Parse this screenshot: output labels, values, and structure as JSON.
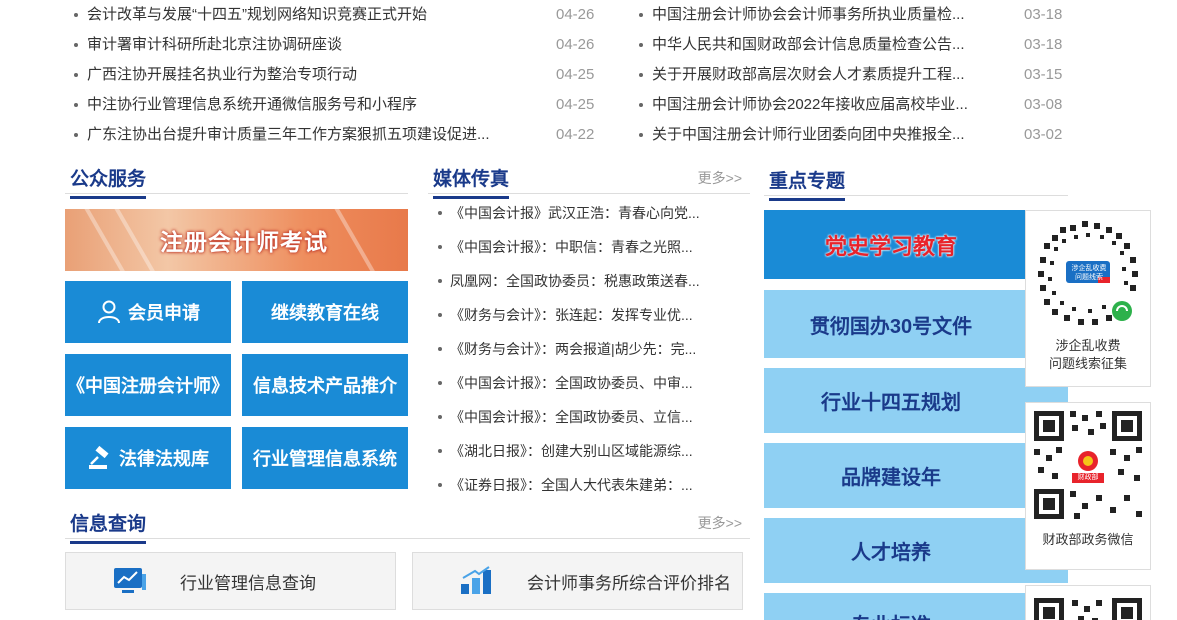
{
  "top_news_left": [
    {
      "title": "会计改革与发展“十四五”规划网络知识竞赛正式开始",
      "date": "04-26"
    },
    {
      "title": "审计署审计科研所赴北京注协调研座谈",
      "date": "04-26"
    },
    {
      "title": "广西注协开展挂名执业行为整治专项行动",
      "date": "04-25"
    },
    {
      "title": "中注协行业管理信息系统开通微信服务号和小程序",
      "date": "04-25"
    },
    {
      "title": "广东注协出台提升审计质量三年工作方案狠抓五项建设促进...",
      "date": "04-22"
    }
  ],
  "top_news_right": [
    {
      "title": "中国注册会计师协会会计师事务所执业质量检...",
      "date": "03-18"
    },
    {
      "title": "中华人民共和国财政部会计信息质量检查公告...",
      "date": "03-18"
    },
    {
      "title": "关于开展财政部高层次财会人才素质提升工程...",
      "date": "03-15"
    },
    {
      "title": "中国注册会计师协会2022年接收应届高校毕业...",
      "date": "03-08"
    },
    {
      "title": "关于中国注册会计师行业团委向团中央推报全...",
      "date": "03-02"
    }
  ],
  "public_service": {
    "title": "公众服务",
    "banner": "注册会计师考试",
    "buttons": [
      "会员申请",
      "继续教育在线",
      "《中国注册会计师》",
      "信息技术产品推介",
      "法律法规库",
      "行业管理信息系统"
    ]
  },
  "media": {
    "title": "媒体传真",
    "more": "更多>>",
    "items": [
      "《中国会计报》武汉正浩：青春心向党...",
      "《中国会计报》：中职信：青春之光照...",
      "凤凰网：全国政协委员：税惠政策送春...",
      "《财务与会计》：张连起：发挥专业优...",
      "《财务与会计》：两会报道|胡少先：完...",
      "《中国会计报》：全国政协委员、中审...",
      "《中国会计报》：全国政协委员、立信...",
      "《湖北日报》：创建大别山区域能源综...",
      "《证券日报》：全国人大代表朱建弟：..."
    ]
  },
  "info_query": {
    "title": "信息查询",
    "more": "更多>>",
    "items": [
      "行业管理信息查询",
      "会计师事务所综合评价排名"
    ]
  },
  "topics": {
    "title": "重点专题",
    "items": [
      "党史学习教育",
      "贯彻国办30号文件",
      "行业十四五规划",
      "品牌建设年",
      "人才培养",
      "专业标准"
    ]
  },
  "qr": {
    "card1_caption": [
      "涉企乱收费",
      "问题线索征集"
    ],
    "card1_badge": [
      "涉企乱收费",
      "问题线索"
    ],
    "card2_caption": "财政部政务微信",
    "card2_badge": "财政部"
  },
  "colors": {
    "brand": "#1a3a8a",
    "service": "#1a8bd6",
    "topic_light": "#8fd0f3",
    "topic_dark": "#1a8bd6",
    "topic_red": "#e8232b"
  }
}
